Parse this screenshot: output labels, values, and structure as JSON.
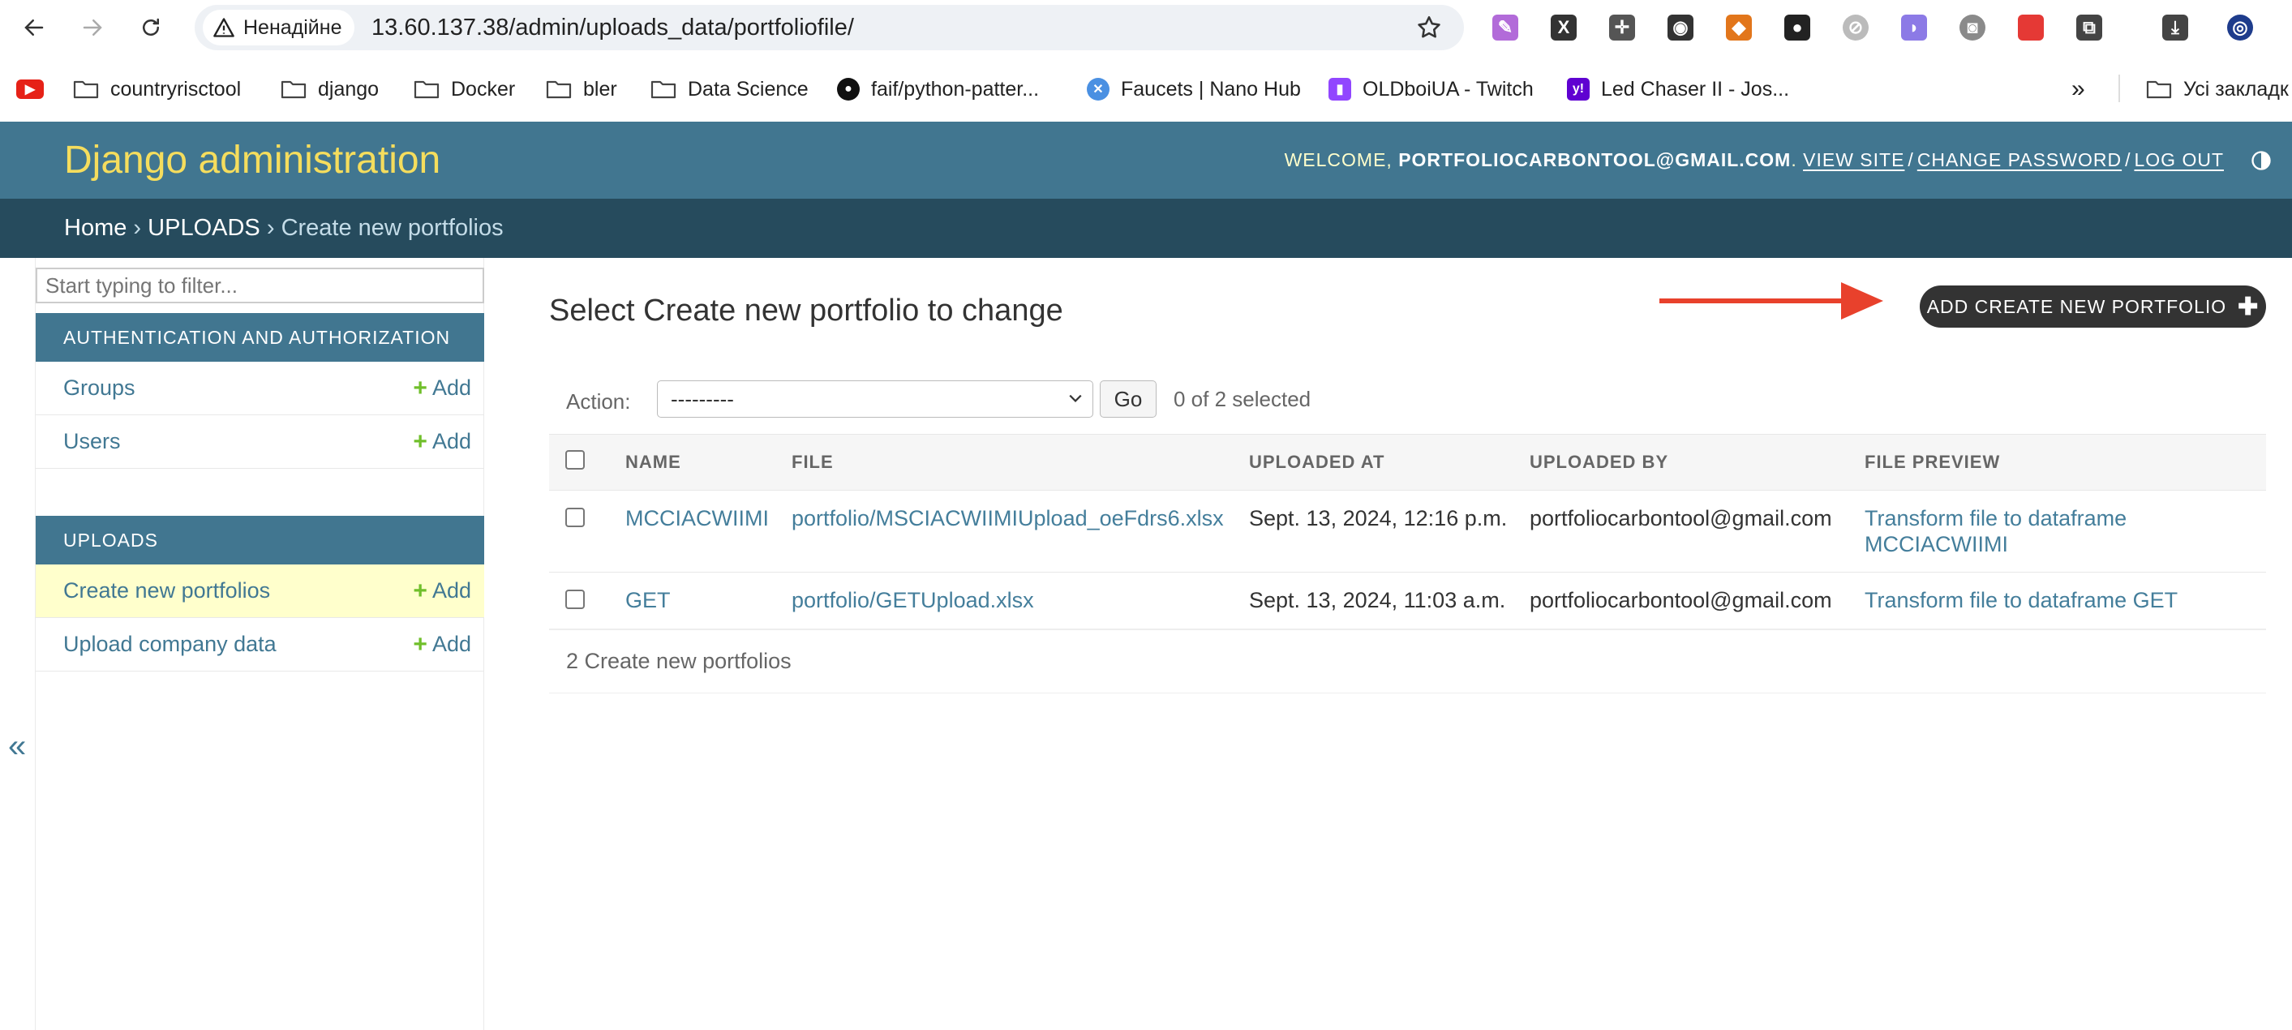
{
  "browser": {
    "security_label": "Ненадійне",
    "url": "13.60.137.38/admin/uploads_data/portfoliofile/",
    "extensions": [
      {
        "name": "feather-icon",
        "color": "#b26bd9",
        "glyph": "✎"
      },
      {
        "name": "x-square-icon",
        "color": "#333333",
        "glyph": "X"
      },
      {
        "name": "move-cross-icon",
        "color": "#555555",
        "glyph": "✛"
      },
      {
        "name": "incognito-mask-icon",
        "color": "#333333",
        "glyph": "◉"
      },
      {
        "name": "fox-wallet-icon",
        "color": "#e2761b",
        "glyph": "◆"
      },
      {
        "name": "panda-icon",
        "color": "#222222",
        "glyph": "●"
      },
      {
        "name": "compass-icon",
        "color": "#bbbbbb",
        "glyph": "⊘"
      },
      {
        "name": "ghost-icon",
        "color": "#8c7ae6",
        "glyph": "◗"
      },
      {
        "name": "camera-icon",
        "color": "#8a8a8a",
        "glyph": "◙"
      },
      {
        "name": "red-square-icon",
        "color": "#e53935",
        "glyph": ""
      },
      {
        "name": "puzzle-extensions-icon",
        "color": "#444444",
        "glyph": "⧉"
      },
      {
        "name": "download-icon",
        "color": "#444444",
        "glyph": "⤓"
      },
      {
        "name": "profile-globe-icon",
        "color": "#1e3c8c",
        "glyph": "◎"
      }
    ]
  },
  "bookmarks": {
    "items": [
      {
        "label": "countryrisctool"
      },
      {
        "label": "django"
      },
      {
        "label": "Docker"
      },
      {
        "label": "bler"
      },
      {
        "label": "Data Science"
      },
      {
        "label": "faif/python-patter..."
      },
      {
        "label": "Faucets | Nano Hub"
      },
      {
        "label": "OLDboiUA - Twitch"
      },
      {
        "label": "Led Chaser II - Jos..."
      }
    ],
    "overflow": "»",
    "all_bookmarks": "Усі закладк"
  },
  "header": {
    "branding": "Django administration",
    "welcome": "Welcome, ",
    "username": "portfoliocarbontool@gmail.com",
    "view_site": "View site",
    "change_password": "Change password",
    "log_out": "Log out"
  },
  "breadcrumbs": {
    "home": "Home",
    "app": "UPLOADS",
    "current": "Create new portfolios",
    "separator": "›"
  },
  "sidebar": {
    "collapse": "«",
    "filter_placeholder": "Start typing to filter...",
    "modules": [
      {
        "caption": "Authentication and Authorization",
        "models": [
          {
            "label": "Groups",
            "add": "Add"
          },
          {
            "label": "Users",
            "add": "Add"
          }
        ]
      },
      {
        "caption": "Uploads",
        "models": [
          {
            "label": "Create new portfolios",
            "add": "Add",
            "current": true
          },
          {
            "label": "Upload company data",
            "add": "Add"
          }
        ]
      }
    ]
  },
  "content": {
    "title": "Select Create new portfolio to change",
    "add_button": "Add Create new portfolio",
    "arrow_color": "#e8412c",
    "actions": {
      "label": "Action:",
      "selected_option": "---------",
      "go": "Go",
      "counter": "0 of 2 selected"
    },
    "table": {
      "columns": [
        "Name",
        "File",
        "Uploaded at",
        "Uploaded by",
        "File preview"
      ],
      "rows": [
        {
          "name": "MCCIACWIIMI",
          "file": "portfolio/MSCIACWIIMIUpload_oeFdrs6.xlsx",
          "uploaded_at": "Sept. 13, 2024, 12:16 p.m.",
          "uploaded_by": "portfoliocarbontool@gmail.com",
          "preview_line1": "Transform file to dataframe",
          "preview_line2": "MCCIACWIIMI"
        },
        {
          "name": "GET",
          "file": "portfolio/GETUpload.xlsx",
          "uploaded_at": "Sept. 13, 2024, 11:03 a.m.",
          "uploaded_by": "portfoliocarbontool@gmail.com",
          "preview_line1": "Transform file to dataframe GET",
          "preview_line2": ""
        }
      ]
    },
    "paginator": "2 Create new portfolios"
  }
}
